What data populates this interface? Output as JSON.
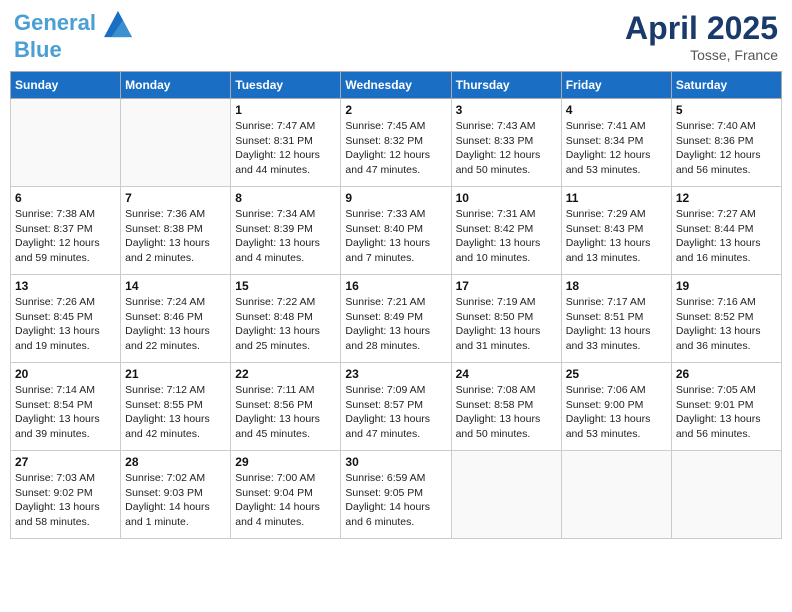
{
  "header": {
    "logo_line1": "General",
    "logo_line2": "Blue",
    "month": "April 2025",
    "location": "Tosse, France"
  },
  "days_of_week": [
    "Sunday",
    "Monday",
    "Tuesday",
    "Wednesday",
    "Thursday",
    "Friday",
    "Saturday"
  ],
  "weeks": [
    [
      {
        "day": "",
        "info": ""
      },
      {
        "day": "",
        "info": ""
      },
      {
        "day": "1",
        "info": "Sunrise: 7:47 AM\nSunset: 8:31 PM\nDaylight: 12 hours and 44 minutes."
      },
      {
        "day": "2",
        "info": "Sunrise: 7:45 AM\nSunset: 8:32 PM\nDaylight: 12 hours and 47 minutes."
      },
      {
        "day": "3",
        "info": "Sunrise: 7:43 AM\nSunset: 8:33 PM\nDaylight: 12 hours and 50 minutes."
      },
      {
        "day": "4",
        "info": "Sunrise: 7:41 AM\nSunset: 8:34 PM\nDaylight: 12 hours and 53 minutes."
      },
      {
        "day": "5",
        "info": "Sunrise: 7:40 AM\nSunset: 8:36 PM\nDaylight: 12 hours and 56 minutes."
      }
    ],
    [
      {
        "day": "6",
        "info": "Sunrise: 7:38 AM\nSunset: 8:37 PM\nDaylight: 12 hours and 59 minutes."
      },
      {
        "day": "7",
        "info": "Sunrise: 7:36 AM\nSunset: 8:38 PM\nDaylight: 13 hours and 2 minutes."
      },
      {
        "day": "8",
        "info": "Sunrise: 7:34 AM\nSunset: 8:39 PM\nDaylight: 13 hours and 4 minutes."
      },
      {
        "day": "9",
        "info": "Sunrise: 7:33 AM\nSunset: 8:40 PM\nDaylight: 13 hours and 7 minutes."
      },
      {
        "day": "10",
        "info": "Sunrise: 7:31 AM\nSunset: 8:42 PM\nDaylight: 13 hours and 10 minutes."
      },
      {
        "day": "11",
        "info": "Sunrise: 7:29 AM\nSunset: 8:43 PM\nDaylight: 13 hours and 13 minutes."
      },
      {
        "day": "12",
        "info": "Sunrise: 7:27 AM\nSunset: 8:44 PM\nDaylight: 13 hours and 16 minutes."
      }
    ],
    [
      {
        "day": "13",
        "info": "Sunrise: 7:26 AM\nSunset: 8:45 PM\nDaylight: 13 hours and 19 minutes."
      },
      {
        "day": "14",
        "info": "Sunrise: 7:24 AM\nSunset: 8:46 PM\nDaylight: 13 hours and 22 minutes."
      },
      {
        "day": "15",
        "info": "Sunrise: 7:22 AM\nSunset: 8:48 PM\nDaylight: 13 hours and 25 minutes."
      },
      {
        "day": "16",
        "info": "Sunrise: 7:21 AM\nSunset: 8:49 PM\nDaylight: 13 hours and 28 minutes."
      },
      {
        "day": "17",
        "info": "Sunrise: 7:19 AM\nSunset: 8:50 PM\nDaylight: 13 hours and 31 minutes."
      },
      {
        "day": "18",
        "info": "Sunrise: 7:17 AM\nSunset: 8:51 PM\nDaylight: 13 hours and 33 minutes."
      },
      {
        "day": "19",
        "info": "Sunrise: 7:16 AM\nSunset: 8:52 PM\nDaylight: 13 hours and 36 minutes."
      }
    ],
    [
      {
        "day": "20",
        "info": "Sunrise: 7:14 AM\nSunset: 8:54 PM\nDaylight: 13 hours and 39 minutes."
      },
      {
        "day": "21",
        "info": "Sunrise: 7:12 AM\nSunset: 8:55 PM\nDaylight: 13 hours and 42 minutes."
      },
      {
        "day": "22",
        "info": "Sunrise: 7:11 AM\nSunset: 8:56 PM\nDaylight: 13 hours and 45 minutes."
      },
      {
        "day": "23",
        "info": "Sunrise: 7:09 AM\nSunset: 8:57 PM\nDaylight: 13 hours and 47 minutes."
      },
      {
        "day": "24",
        "info": "Sunrise: 7:08 AM\nSunset: 8:58 PM\nDaylight: 13 hours and 50 minutes."
      },
      {
        "day": "25",
        "info": "Sunrise: 7:06 AM\nSunset: 9:00 PM\nDaylight: 13 hours and 53 minutes."
      },
      {
        "day": "26",
        "info": "Sunrise: 7:05 AM\nSunset: 9:01 PM\nDaylight: 13 hours and 56 minutes."
      }
    ],
    [
      {
        "day": "27",
        "info": "Sunrise: 7:03 AM\nSunset: 9:02 PM\nDaylight: 13 hours and 58 minutes."
      },
      {
        "day": "28",
        "info": "Sunrise: 7:02 AM\nSunset: 9:03 PM\nDaylight: 14 hours and 1 minute."
      },
      {
        "day": "29",
        "info": "Sunrise: 7:00 AM\nSunset: 9:04 PM\nDaylight: 14 hours and 4 minutes."
      },
      {
        "day": "30",
        "info": "Sunrise: 6:59 AM\nSunset: 9:05 PM\nDaylight: 14 hours and 6 minutes."
      },
      {
        "day": "",
        "info": ""
      },
      {
        "day": "",
        "info": ""
      },
      {
        "day": "",
        "info": ""
      }
    ]
  ]
}
